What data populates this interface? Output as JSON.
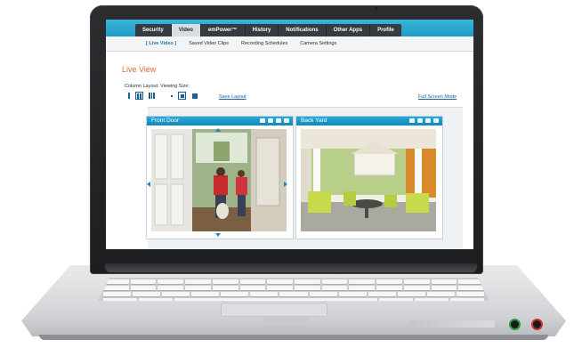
{
  "nav": {
    "main_tabs": [
      {
        "label": "Security",
        "active": false
      },
      {
        "label": "Video",
        "active": true
      },
      {
        "label": "emPower™",
        "active": false
      },
      {
        "label": "History",
        "active": false
      },
      {
        "label": "Notifications",
        "active": false
      },
      {
        "label": "Other Apps",
        "active": false
      },
      {
        "label": "Profile",
        "active": false
      }
    ],
    "sub_tabs": [
      {
        "label": "[ Live Video ]",
        "active": true
      },
      {
        "label": "Saved Video Clips",
        "active": false
      },
      {
        "label": "Recording Schedules",
        "active": false
      },
      {
        "label": "Camera Settings",
        "active": false
      }
    ]
  },
  "page": {
    "title": "Live View",
    "layout_label": "Column Layout: Viewing Size:",
    "save_layout": "Save Layout",
    "full_screen": "Full Screen Mode"
  },
  "cameras": [
    {
      "name": "Front Door"
    },
    {
      "name": "Back Yard"
    }
  ],
  "colors": {
    "header_blue": "#1a9ac4",
    "tab_bar": "#353b40",
    "title_orange": "#e2663a",
    "link_blue": "#1a5e9c",
    "camera_title_blue": "#1288bb"
  },
  "icons": [
    "layout-1col-icon",
    "layout-2col-icon",
    "layout-3col-icon",
    "size-small-icon",
    "size-medium-icon",
    "size-large-icon",
    "snapshot-icon",
    "record-icon",
    "settings-icon",
    "expand-icon",
    "pan-up-icon",
    "pan-down-icon",
    "pan-left-icon",
    "pan-right-icon"
  ]
}
